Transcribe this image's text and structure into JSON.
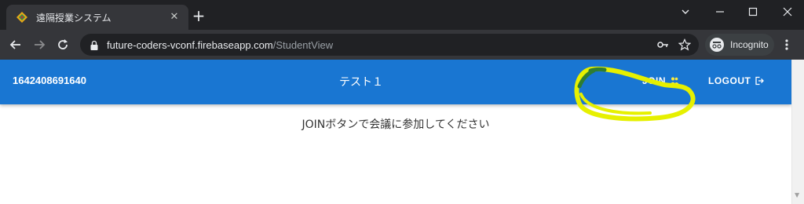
{
  "browser": {
    "tab_title": "遠隔授業システム",
    "tab_close_glyph": "✕",
    "new_tab_glyph": "+",
    "url_host": "future-coders-vconf.firebaseapp.com",
    "url_path": "/StudentView",
    "incognito_label": "Incognito",
    "icons": [
      "back-icon",
      "forward-icon",
      "reload-icon",
      "lock-icon",
      "key-icon",
      "star-icon",
      "incognito-icon",
      "more-icon"
    ]
  },
  "app": {
    "user_id": "1642408691640",
    "title": "テスト１",
    "join_label": "JOIN",
    "logout_label": "LOGOUT",
    "message": "JOINボタンで会議に参加してください",
    "colors": {
      "appbar": "#1976d2",
      "highlight": "#e6f000"
    }
  }
}
